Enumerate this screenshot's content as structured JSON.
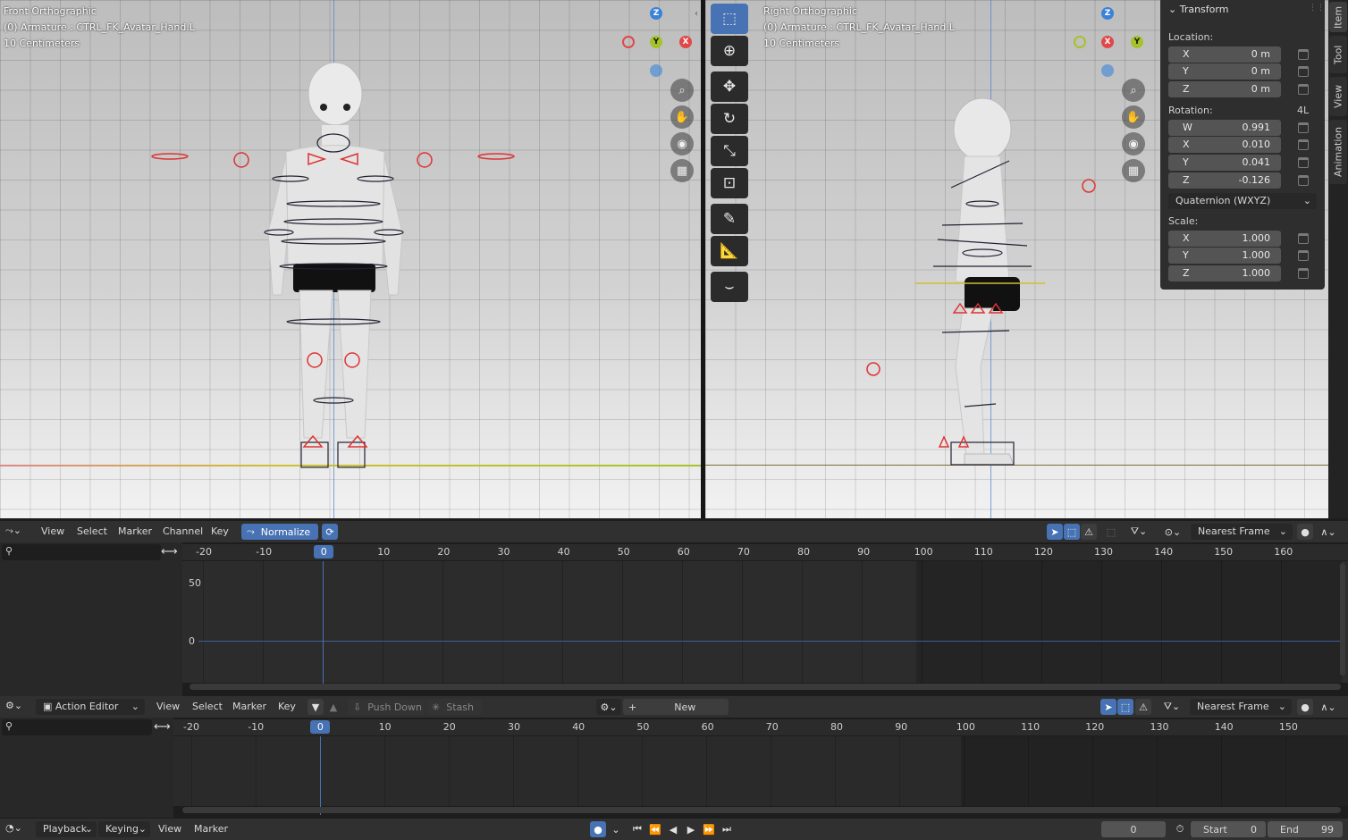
{
  "viewport_left": {
    "title": "Front Orthographic",
    "object": "(0) Armature : CTRL_FK_Avatar_Hand.L",
    "scale": "10 Centimeters"
  },
  "viewport_right": {
    "title": "Right Orthographic",
    "object": "(0) Armature : CTRL_FK_Avatar_Hand.L",
    "scale": "10 Centimeters"
  },
  "gizmo": {
    "z": "Z",
    "y": "Y",
    "x": "X"
  },
  "transform": {
    "title": "Transform",
    "location_label": "Location:",
    "location": [
      {
        "k": "X",
        "v": "0 m"
      },
      {
        "k": "Y",
        "v": "0 m"
      },
      {
        "k": "Z",
        "v": "0 m"
      }
    ],
    "rotation_label": "Rotation:",
    "rotation_mode_short": "4L",
    "rotation": [
      {
        "k": "W",
        "v": "0.991"
      },
      {
        "k": "X",
        "v": "0.010"
      },
      {
        "k": "Y",
        "v": "0.041"
      },
      {
        "k": "Z",
        "v": "-0.126"
      }
    ],
    "rotation_mode": "Quaternion (WXYZ)",
    "scale_label": "Scale:",
    "scale": [
      {
        "k": "X",
        "v": "1.000"
      },
      {
        "k": "Y",
        "v": "1.000"
      },
      {
        "k": "Z",
        "v": "1.000"
      }
    ]
  },
  "side_tabs": [
    "Item",
    "Tool",
    "View",
    "Animation"
  ],
  "graph_editor": {
    "menus": [
      "View",
      "Select",
      "Marker",
      "Channel",
      "Key"
    ],
    "normalize": "Normalize",
    "snap": "Nearest Frame",
    "ruler": [
      "-20",
      "-10",
      "0",
      "10",
      "20",
      "30",
      "40",
      "50",
      "60",
      "70",
      "80",
      "90",
      "100",
      "110",
      "120",
      "130",
      "140",
      "150",
      "160"
    ],
    "current_frame": "0",
    "y_labels": [
      "50",
      "0"
    ]
  },
  "action_editor": {
    "mode": "Action Editor",
    "menus": [
      "View",
      "Select",
      "Marker",
      "Key"
    ],
    "push_down": "Push Down",
    "stash": "Stash",
    "new": "New",
    "snap": "Nearest Frame",
    "ruler": [
      "-20",
      "-10",
      "0",
      "10",
      "20",
      "30",
      "40",
      "50",
      "60",
      "70",
      "80",
      "90",
      "100",
      "110",
      "120",
      "130",
      "140",
      "150"
    ],
    "current_frame": "0"
  },
  "timeline": {
    "menus": [
      "Playback",
      "Keying",
      "View",
      "Marker"
    ],
    "frame": "0",
    "start_label": "Start",
    "start": "0",
    "end_label": "End",
    "end": "99"
  },
  "colors": {
    "accent": "#4772b3",
    "x_axis": "#e04848",
    "y_axis": "#8cb820",
    "z_axis": "#3a83d8"
  }
}
